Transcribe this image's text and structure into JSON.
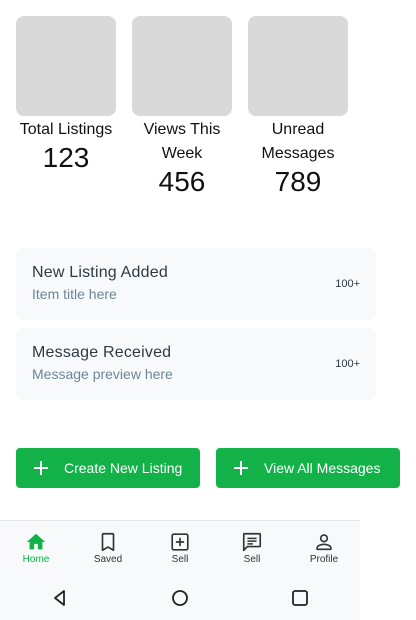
{
  "stats": [
    {
      "label": "Total Listings",
      "value": "123"
    },
    {
      "label": "Views This Week",
      "value": "456"
    },
    {
      "label": "Unread Messages",
      "value": "789"
    }
  ],
  "activity": [
    {
      "title": "New Listing Added",
      "subtitle": "Item title here",
      "count": "100+"
    },
    {
      "title": "Message Received",
      "subtitle": "Message preview here",
      "count": "100+"
    }
  ],
  "actions": {
    "create_label": "Create New Listing",
    "view_messages_label": "View All Messages"
  },
  "bottom_nav": [
    {
      "label": "Home",
      "icon": "home-icon",
      "active": true
    },
    {
      "label": "Saved",
      "icon": "bookmark-icon",
      "active": false
    },
    {
      "label": "Sell",
      "icon": "add-box-icon",
      "active": false
    },
    {
      "label": "Sell",
      "icon": "message-icon",
      "active": false
    },
    {
      "label": "Profile",
      "icon": "person-icon",
      "active": false
    }
  ],
  "colors": {
    "accent": "#12b248",
    "placeholder": "#d9d9d9",
    "card_bg": "#f7f9fa"
  }
}
